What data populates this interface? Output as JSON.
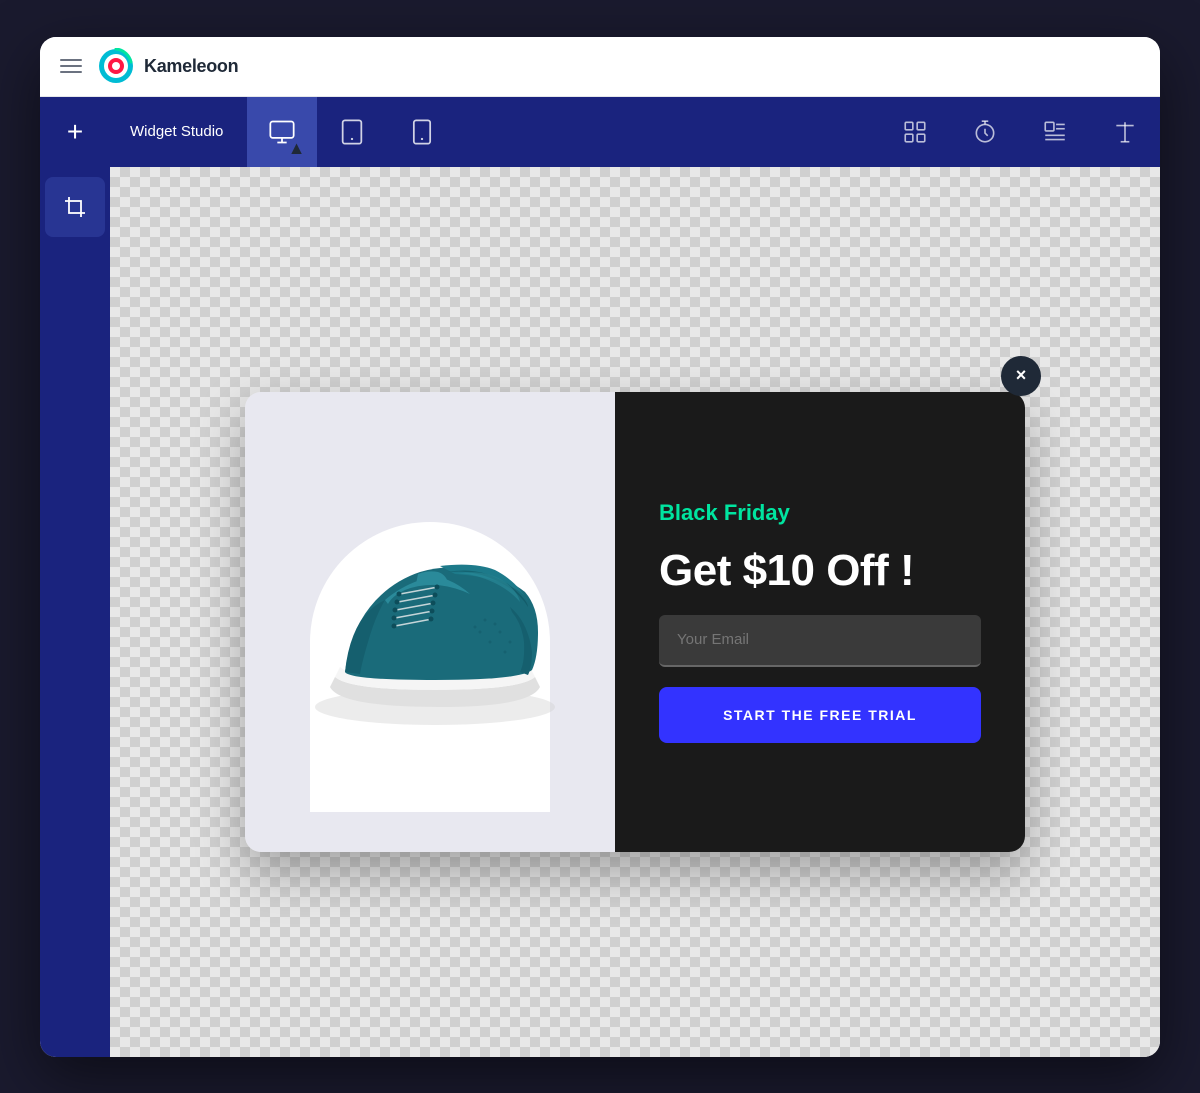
{
  "app": {
    "title": "Kameleoon",
    "hamburger_label": "Menu"
  },
  "toolbar": {
    "add_button_label": "+",
    "widget_studio_label": "Widget Studio",
    "devices": [
      {
        "id": "desktop",
        "label": "Desktop",
        "active": true
      },
      {
        "id": "tablet",
        "label": "Tablet",
        "active": false
      },
      {
        "id": "mobile",
        "label": "Mobile",
        "active": false
      }
    ],
    "right_icons": [
      {
        "id": "grid",
        "label": "Grid"
      },
      {
        "id": "timer",
        "label": "Timer"
      },
      {
        "id": "image-text",
        "label": "Image Text"
      },
      {
        "id": "font",
        "label": "Font"
      }
    ]
  },
  "sidebar": {
    "tools": [
      {
        "id": "crop",
        "label": "Crop Tool"
      }
    ]
  },
  "popup": {
    "close_button_label": "×",
    "black_friday_label": "Black Friday",
    "headline": "Get $10 Off !",
    "email_placeholder": "Your Email",
    "cta_button_label": "START THE FREE TRIAL"
  },
  "colors": {
    "nav_bg": "#1a237e",
    "active_tab": "#3949ab",
    "accent_green": "#00e5a0",
    "cta_blue": "#3333ff",
    "popup_dark": "#1a1a1a",
    "close_bg": "#1f2937"
  }
}
